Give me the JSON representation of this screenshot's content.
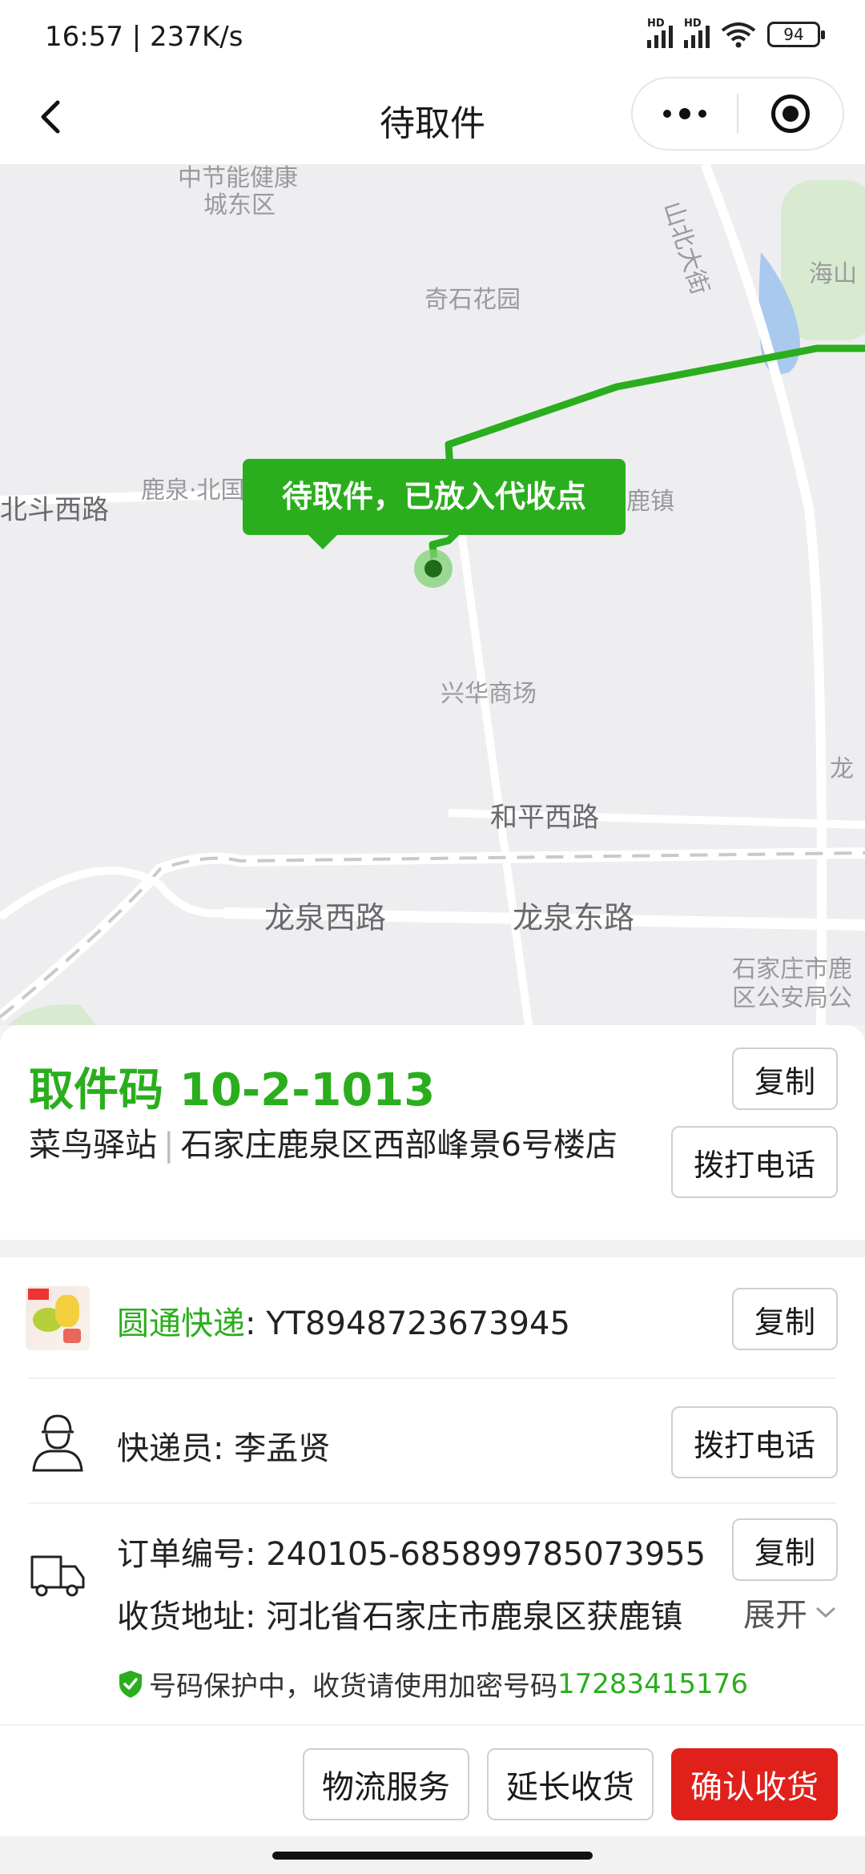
{
  "status_bar": {
    "time": "16:57 | 237K/s",
    "battery": "94",
    "hd": "HD"
  },
  "nav": {
    "title": "待取件"
  },
  "map": {
    "labels": [
      "中节能健康",
      "城东区",
      "山北大街",
      "海山",
      "奇石花园",
      "鹿泉·北国",
      "北斗西路",
      "鹿镇",
      "兴华商场",
      "和平西路",
      "龙泉西路",
      "龙泉东路",
      "石家庄市鹿",
      "区公安局公",
      "龙"
    ],
    "bubble": "待取件，已放入代收点",
    "route_color": "#2aae1d"
  },
  "pickup": {
    "code_label": "取件码",
    "code": "10-2-1013",
    "station": "菜鸟驿站",
    "separator": "|",
    "address": "石家庄鹿泉区西部峰景6号楼店",
    "copy_label": "复制",
    "call_label": "拨打电话"
  },
  "details": {
    "carrier": "圆通快递",
    "tracking_no": ": YT8948723673945",
    "copy_label": "复制",
    "courier": "快递员: 李孟贤",
    "call_label": "拨打电话",
    "order_no": "订单编号: 240105-685899785073955",
    "order_copy_label": "复制",
    "address": "收货地址: 河北省石家庄市鹿泉区获鹿镇",
    "expand_label": "展开",
    "protect_text": "号码保护中，收货请使用加密号码",
    "protect_number": "17283415176"
  },
  "bottom": {
    "logistics": "物流服务",
    "extend": "延长收货",
    "confirm": "确认收货"
  },
  "colors": {
    "accent": "#2aae1d",
    "danger": "#e0201b"
  }
}
